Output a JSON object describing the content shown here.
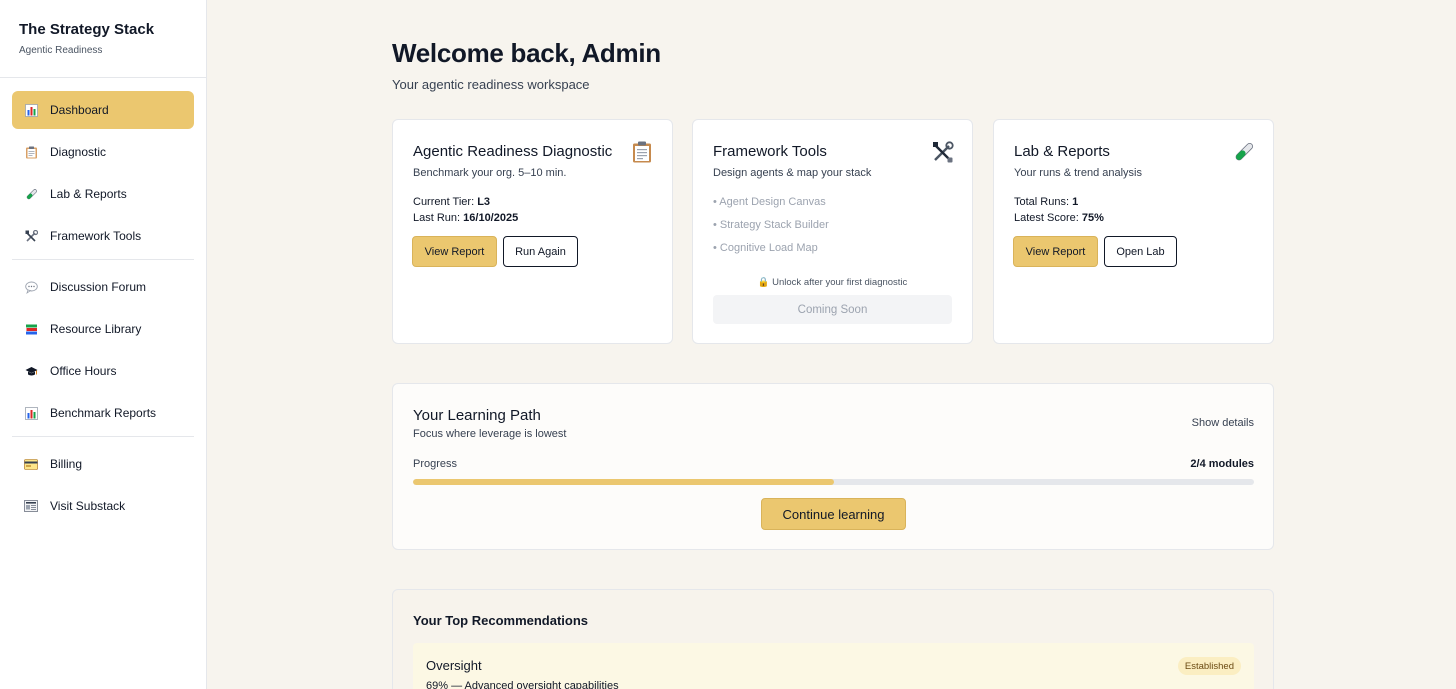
{
  "brand": {
    "title": "The Strategy Stack",
    "subtitle": "Agentic Readiness"
  },
  "sidebar": {
    "group1": [
      {
        "label": "Dashboard",
        "icon": "bar-chart-icon",
        "active": true
      },
      {
        "label": "Diagnostic",
        "icon": "clipboard-icon"
      },
      {
        "label": "Lab & Reports",
        "icon": "test-tube-icon"
      },
      {
        "label": "Framework Tools",
        "icon": "tools-icon"
      }
    ],
    "group2": [
      {
        "label": "Discussion Forum",
        "icon": "speech-bubble-icon"
      },
      {
        "label": "Resource Library",
        "icon": "books-icon"
      },
      {
        "label": "Office Hours",
        "icon": "graduation-cap-icon"
      },
      {
        "label": "Benchmark Reports",
        "icon": "bar-chart-icon"
      }
    ],
    "group3": [
      {
        "label": "Billing",
        "icon": "credit-card-icon"
      },
      {
        "label": "Visit Substack",
        "icon": "newspaper-icon"
      }
    ]
  },
  "header": {
    "title": "Welcome back, Admin",
    "subtitle": "Your agentic readiness workspace"
  },
  "cards": {
    "diagnostic": {
      "title": "Agentic Readiness Diagnostic",
      "subtitle": "Benchmark your org. 5–10 min.",
      "tier_label": "Current Tier:",
      "tier_value": "L3",
      "last_run_label": "Last Run:",
      "last_run_value": "16/10/2025",
      "primary": "View Report",
      "secondary": "Run Again"
    },
    "framework": {
      "title": "Framework Tools",
      "subtitle": "Design agents & map your stack",
      "items": [
        "• Agent Design Canvas",
        "• Strategy Stack Builder",
        "• Cognitive Load Map"
      ],
      "unlock": "🔒 Unlock after your first diagnostic",
      "coming_soon": "Coming Soon"
    },
    "lab": {
      "title": "Lab & Reports",
      "subtitle": "Your runs & trend analysis",
      "runs_label": "Total Runs:",
      "runs_value": "1",
      "score_label": "Latest Score:",
      "score_value": "75%",
      "primary": "View Report",
      "secondary": "Open Lab"
    }
  },
  "learning_path": {
    "title": "Your Learning Path",
    "subtitle": "Focus where leverage is lowest",
    "show_details": "Show details",
    "progress_label": "Progress",
    "progress_count": "2/4 modules",
    "progress_fraction": 0.5,
    "cta": "Continue learning"
  },
  "recommendations": {
    "title": "Your Top Recommendations",
    "items": [
      {
        "name": "Oversight",
        "description": "69% — Advanced oversight capabilities",
        "badge": "Established"
      }
    ]
  },
  "colors": {
    "accent": "#ebc76f",
    "background": "#f7f4ee"
  }
}
